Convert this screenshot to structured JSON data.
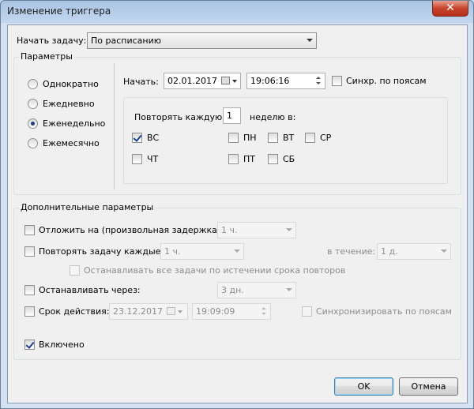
{
  "window": {
    "title": "Изменение триггера",
    "close": "✕"
  },
  "begin_task": {
    "label": "Начать задачу:",
    "value": "По расписанию"
  },
  "params": {
    "title": "Параметры",
    "radios": [
      {
        "label": "Однократно",
        "checked": false
      },
      {
        "label": "Ежедневно",
        "checked": false
      },
      {
        "label": "Еженедельно",
        "checked": true
      },
      {
        "label": "Ежемесячно",
        "checked": false
      }
    ],
    "start_label": "Начать:",
    "start_date": "02.01.2017",
    "start_time": "19:06:16",
    "sync_label": "Синхр. по поясам",
    "repeat_label": "Повторять каждую",
    "repeat_value": "1",
    "week_label": "неделю в:",
    "days": [
      {
        "label": "ВС",
        "checked": true
      },
      {
        "label": "ПН",
        "checked": false
      },
      {
        "label": "ВТ",
        "checked": false
      },
      {
        "label": "СР",
        "checked": false
      },
      {
        "label": "ЧТ",
        "checked": false
      },
      {
        "label": "ПТ",
        "checked": false
      },
      {
        "label": "СБ",
        "checked": false
      }
    ]
  },
  "advanced": {
    "title": "Дополнительные параметры",
    "delay_label": "Отложить на (произвольная задержка):",
    "delay_value": "1 ч.",
    "repeat_label": "Повторять задачу каждые:",
    "repeat_value": "1 ч.",
    "during_label": "в течение:",
    "during_value": "1 д.",
    "stop_all_label": "Останавливать все задачи по истечении срока повторов",
    "stop_after_label": "Останавливать через:",
    "stop_after_value": "3 дн.",
    "expire_label": "Срок действия:",
    "expire_date": "23.12.2017",
    "expire_time": "19:09:09",
    "expire_sync_label": "Синхронизировать по поясам",
    "enabled_label": "Включено"
  },
  "buttons": {
    "ok": "OK",
    "cancel": "Отмена"
  }
}
